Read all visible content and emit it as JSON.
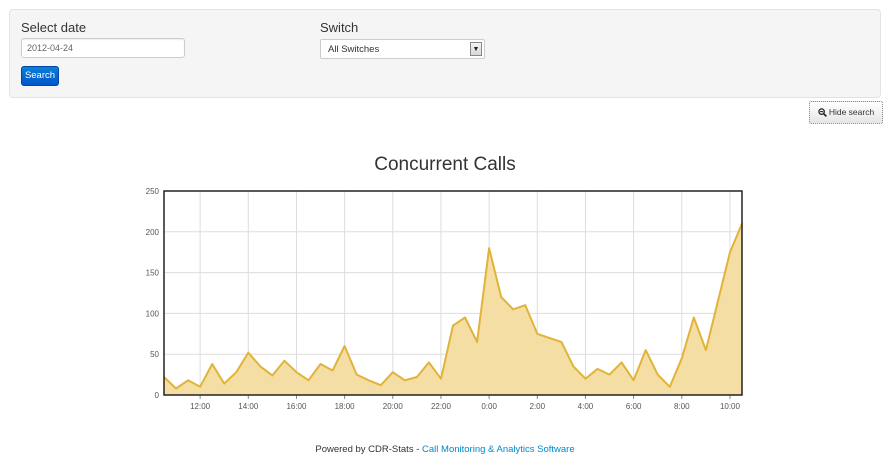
{
  "search": {
    "date_label": "Select date",
    "date_value": "2012-04-24",
    "switch_label": "Switch",
    "switch_value": "All Switches",
    "search_button": "Search"
  },
  "hide_search_button": "Hide search",
  "chart_data": {
    "type": "area",
    "title": "Concurrent Calls",
    "xlabel": "",
    "ylabel": "",
    "ylim": [
      0,
      250
    ],
    "yticks": [
      0,
      50,
      100,
      150,
      200,
      250
    ],
    "xticks": [
      "12:00",
      "14:00",
      "16:00",
      "18:00",
      "20:00",
      "22:00",
      "0:00",
      "2:00",
      "4:00",
      "6:00",
      "8:00",
      "10:00"
    ],
    "x_range_hours": [
      10.5,
      34.5
    ],
    "grid": true,
    "fill_color": "#f5dea3",
    "line_color": "#e0b43a",
    "series": [
      {
        "x": [
          10.5,
          11.0,
          11.5,
          12.0,
          12.5,
          13.0,
          13.5,
          14.0,
          14.5,
          15.0,
          15.5,
          16.0,
          16.5,
          17.0,
          17.5,
          18.0,
          18.5,
          19.0,
          19.5,
          20.0,
          20.5,
          21.0,
          21.5,
          22.0,
          22.5,
          23.0,
          23.5,
          24.0,
          24.5,
          25.0,
          25.5,
          26.0,
          26.5,
          27.0,
          27.5,
          28.0,
          28.5,
          29.0,
          29.5,
          30.0,
          30.5,
          31.0,
          31.5,
          32.0,
          32.5,
          33.0,
          33.5,
          34.0,
          34.5
        ],
        "values": [
          22,
          8,
          18,
          10,
          38,
          14,
          28,
          52,
          35,
          24,
          42,
          28,
          18,
          38,
          30,
          60,
          25,
          18,
          12,
          28,
          18,
          22,
          40,
          20,
          85,
          95,
          65,
          180,
          120,
          105,
          110,
          75,
          70,
          65,
          35,
          20,
          32,
          25,
          40,
          18,
          55,
          25,
          10,
          45,
          95,
          55,
          115,
          175,
          210
        ]
      }
    ]
  },
  "footer": {
    "prefix": "Powered by CDR-Stats - ",
    "link": "Call Monitoring & Analytics Software"
  },
  "colors": {
    "primary_button": "#0066cc",
    "link": "#0088cc"
  }
}
